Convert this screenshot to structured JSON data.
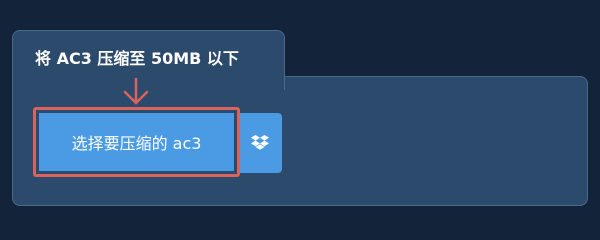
{
  "tab": {
    "title": "将 AC3 压缩至 50MB 以下"
  },
  "upload": {
    "choose_label": "选择要压缩的 ac3",
    "arrow_icon": "arrow-down-icon",
    "dropbox_icon": "dropbox-icon"
  },
  "colors": {
    "page_background": "#13243a",
    "panel_background": "#2c4a6b",
    "panel_border": "#4a6a8c",
    "button_blue": "#4a9be4",
    "highlight_red": "#d9645d"
  }
}
